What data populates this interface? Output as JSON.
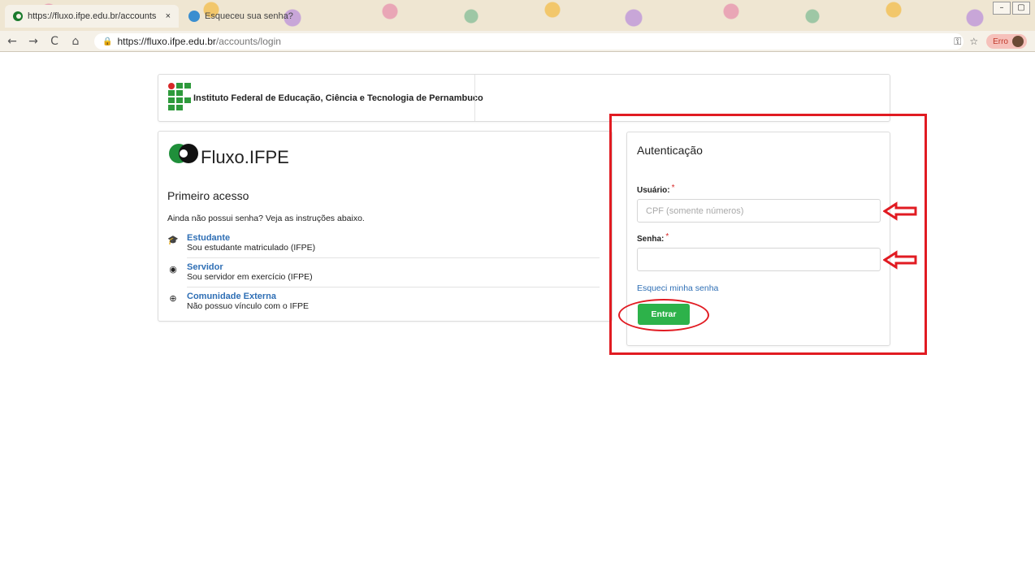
{
  "browser": {
    "tabs": [
      {
        "title": "https://fluxo.ifpe.edu.br/accounts",
        "close": "×"
      },
      {
        "title": "Esqueceu sua senha?"
      }
    ],
    "nav": {
      "back": "←",
      "forward": "→",
      "reload": "C",
      "home": "⌂"
    },
    "url": {
      "host": "https://fluxo.ifpe.edu.br",
      "path": "/accounts/login"
    },
    "profile_error_label": "Erro",
    "window_controls": [
      "–",
      "▢"
    ]
  },
  "header": {
    "institution": "Instituto Federal de Educação, Ciência e Tecnologia de Pernambuco"
  },
  "left": {
    "logo_text": "Fluxo.IFPE",
    "section_title": "Primeiro acesso",
    "description": "Ainda não possui senha? Veja as instruções abaixo.",
    "options": [
      {
        "label": "Estudante",
        "desc": "Sou estudante matriculado (IFPE)",
        "icon": "graduation-cap-icon"
      },
      {
        "label": "Servidor",
        "desc": "Sou servidor em exercício (IFPE)",
        "icon": "user-circle-icon"
      },
      {
        "label": "Comunidade Externa",
        "desc": "Não possuo vínculo com o IFPE",
        "icon": "globe-icon"
      }
    ]
  },
  "auth": {
    "title": "Autenticação",
    "username_label": "Usuário:",
    "username_placeholder": "CPF (somente números)",
    "username_value": "",
    "password_label": "Senha:",
    "password_value": "",
    "required_mark": "*",
    "forgot_link": "Esqueci minha senha",
    "submit": "Entrar"
  },
  "colors": {
    "accent_green": "#2db24a",
    "link_blue": "#2f6fb5",
    "annotation_red": "#e11b22"
  }
}
